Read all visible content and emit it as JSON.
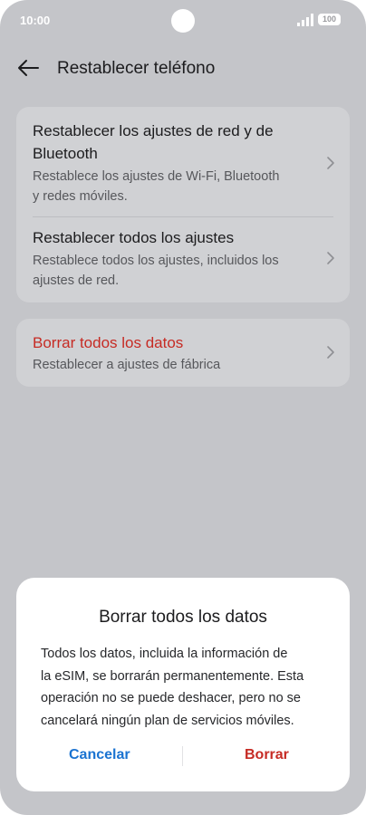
{
  "status": {
    "time": "10:00",
    "battery": "100"
  },
  "header": {
    "title": "Restablecer teléfono"
  },
  "card1": {
    "items": [
      {
        "title_line1": "Restablecer los ajustes de red y de",
        "title_line2": "Bluetooth",
        "sub_line1": "Restablece los ajustes de Wi-Fi, Bluetooth",
        "sub_line2": "y redes móviles."
      },
      {
        "title_line1": "Restablecer todos los ajustes",
        "sub_line1": "Restablece todos los ajustes, incluidos los",
        "sub_line2": "ajustes de red."
      }
    ]
  },
  "card2": {
    "title": "Borrar todos los datos",
    "sub": "Restablecer a ajustes de fábrica"
  },
  "dialog": {
    "title": "Borrar todos los datos",
    "body_line1": "Todos los datos, incluida la información de",
    "body_line2": "la eSIM, se borrarán permanentemente. Esta",
    "body_line3": "operación no se puede deshacer, pero no se",
    "body_line4": "cancelará ningún plan de servicios móviles.",
    "cancel_label": "Cancelar",
    "delete_label": "Borrar"
  },
  "colors": {
    "danger": "#c62b24",
    "accent": "#1a73d1",
    "scrim": "#c4c5c9"
  }
}
